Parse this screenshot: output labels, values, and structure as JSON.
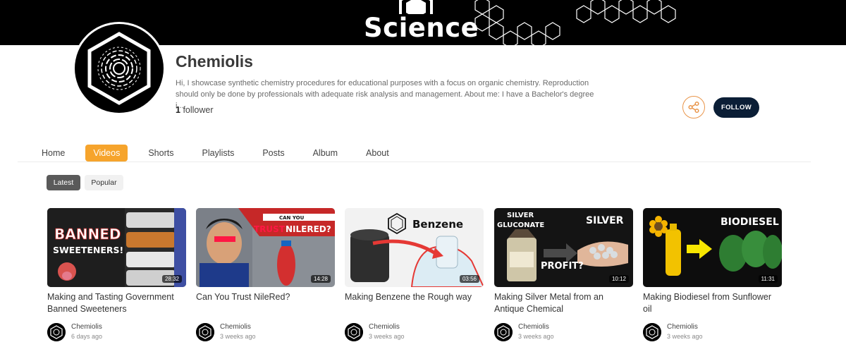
{
  "banner": {
    "word": "Science"
  },
  "channel": {
    "name": "Chemiolis",
    "description": "Hi, I showcase synthetic chemistry procedures for educational purposes with a focus on organic chemistry. Reproduction should only be done by professionals with adequate risk analysis and management. About me: I have a Bachelor's degree i...",
    "follower_count": "1",
    "follower_label": "follower",
    "follow_label": "FOLLOW"
  },
  "tabs": [
    {
      "label": "Home",
      "active": false
    },
    {
      "label": "Videos",
      "active": true
    },
    {
      "label": "Shorts",
      "active": false
    },
    {
      "label": "Playlists",
      "active": false
    },
    {
      "label": "Posts",
      "active": false
    },
    {
      "label": "Album",
      "active": false
    },
    {
      "label": "About",
      "active": false
    }
  ],
  "filters": {
    "latest": "Latest",
    "popular": "Popular",
    "selected": "Latest"
  },
  "videos": [
    {
      "title": "Making and Tasting Government Banned Sweeteners",
      "duration": "28:32",
      "author": "Chemiolis",
      "ago": "6 days ago",
      "thumb_text": [
        "BANNED",
        "SWEETENERS!"
      ]
    },
    {
      "title": "Can You Trust NileRed?",
      "duration": "14:28",
      "author": "Chemiolis",
      "ago": "3 weeks ago",
      "thumb_text": [
        "CAN YOU",
        "TRUST",
        "NILERED?"
      ]
    },
    {
      "title": "Making Benzene the Rough way",
      "duration": "03:56",
      "author": "Chemiolis",
      "ago": "3 weeks ago",
      "thumb_text": [
        "Benzene"
      ]
    },
    {
      "title": "Making Silver Metal from an Antique Chemical",
      "duration": "10:12",
      "author": "Chemiolis",
      "ago": "3 weeks ago",
      "thumb_text": [
        "SILVER",
        "GLUCONATE",
        "SILVER",
        "PROFIT?"
      ]
    },
    {
      "title": "Making Biodiesel from Sunflower oil",
      "duration": "11:31",
      "author": "Chemiolis",
      "ago": "3 weeks ago",
      "thumb_text": [
        "BIODIESEL"
      ]
    }
  ],
  "colors": {
    "accent": "#f6a42c",
    "follow_bg": "#0b1e36",
    "share_border": "#e9954a"
  },
  "icons": {
    "share": "share-icon"
  }
}
